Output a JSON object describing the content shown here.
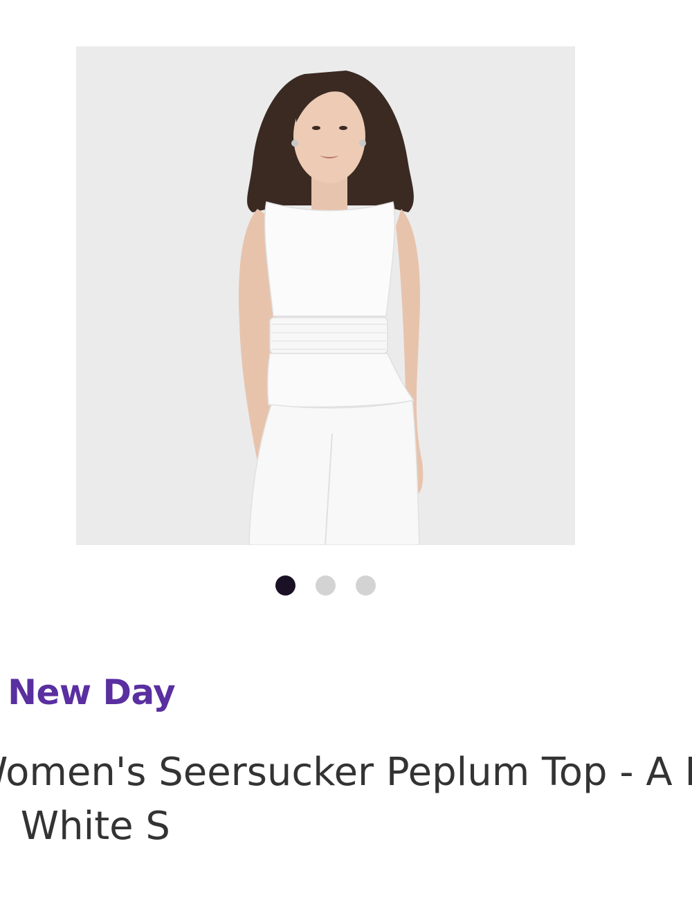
{
  "product": {
    "image_alt": "Woman wearing white sleeveless seersucker peplum top",
    "brand": "A New Day",
    "title_line1": "Women's Seersucker Peplum Top - A New Day",
    "title_line2": "™ White S"
  },
  "carousel": {
    "count": 3,
    "active_index": 0
  },
  "colors": {
    "brand": "#5a2fa0",
    "title": "#333333",
    "dot_active": "#1a1124",
    "dot_inactive": "#d3d3d3",
    "image_bg": "#ebebeb"
  }
}
